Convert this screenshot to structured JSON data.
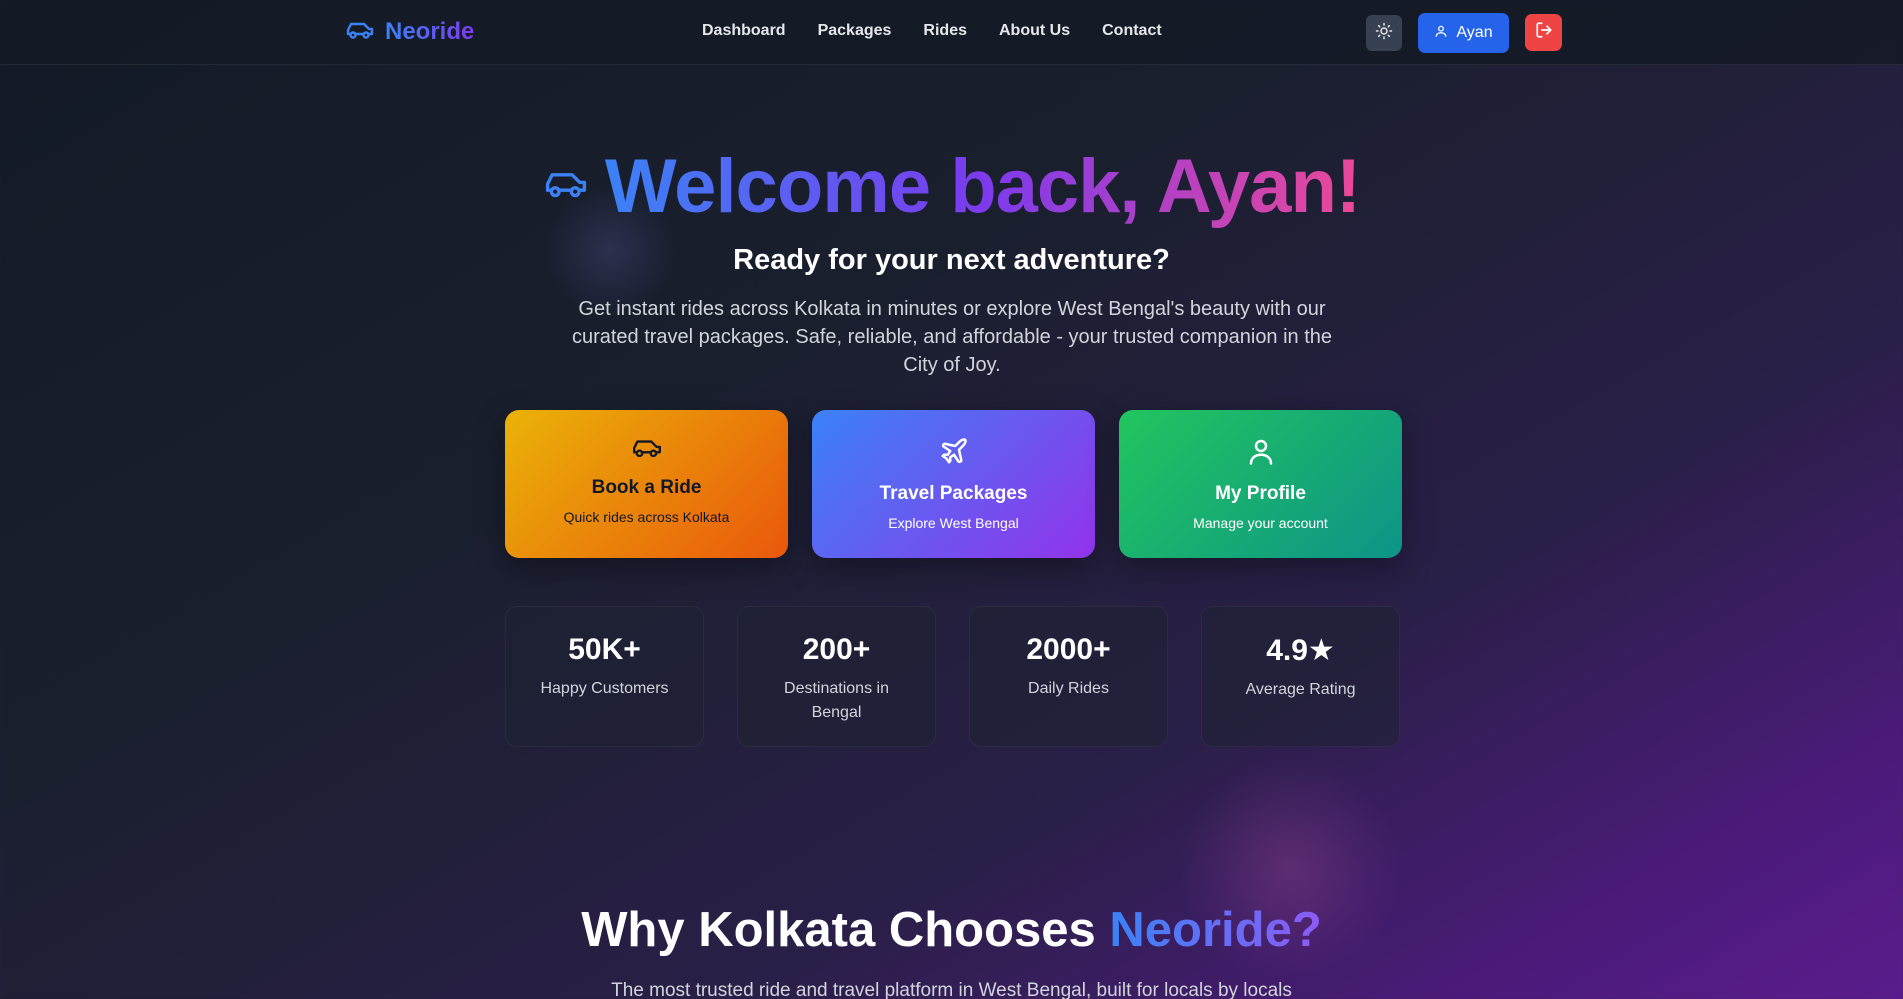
{
  "nav": {
    "brand": "Neoride",
    "links": [
      "Dashboard",
      "Packages",
      "Rides",
      "About Us",
      "Contact"
    ],
    "user_label": "Ayan",
    "icons": {
      "brand": "car-icon",
      "theme": "sun-icon",
      "user": "user-icon",
      "logout": "logout-icon"
    }
  },
  "hero": {
    "title": "Welcome back, Ayan!",
    "subtitle": "Ready for your next adventure?",
    "description": "Get instant rides across Kolkata in minutes or explore West Bengal's beauty with our curated travel packages. Safe, reliable, and affordable - your trusted companion in the City of Joy."
  },
  "actions": [
    {
      "title": "Book a Ride",
      "subtitle": "Quick rides across Kolkata",
      "icon": "car-icon"
    },
    {
      "title": "Travel Packages",
      "subtitle": "Explore West Bengal",
      "icon": "plane-icon"
    },
    {
      "title": "My Profile",
      "subtitle": "Manage your account",
      "icon": "user-icon"
    }
  ],
  "stats": [
    {
      "value": "50K+",
      "label": "Happy Customers"
    },
    {
      "value": "200+",
      "label": "Destinations in Bengal"
    },
    {
      "value": "2000+",
      "label": "Daily Rides"
    },
    {
      "value": "4.9★",
      "label": "Average Rating"
    }
  ],
  "why": {
    "title_prefix": "Why Kolkata Chooses",
    "title_accent": "Neoride?",
    "subtitle": "The most trusted ride and travel platform in West Bengal, built for locals by locals"
  },
  "colors": {
    "primary": "#2563eb",
    "danger": "#ef4444",
    "brand_gradient": [
      "#3b82f6",
      "#7c3aed"
    ],
    "title_gradient": [
      "#3b82f6",
      "#7c3aed",
      "#ec4899"
    ]
  }
}
